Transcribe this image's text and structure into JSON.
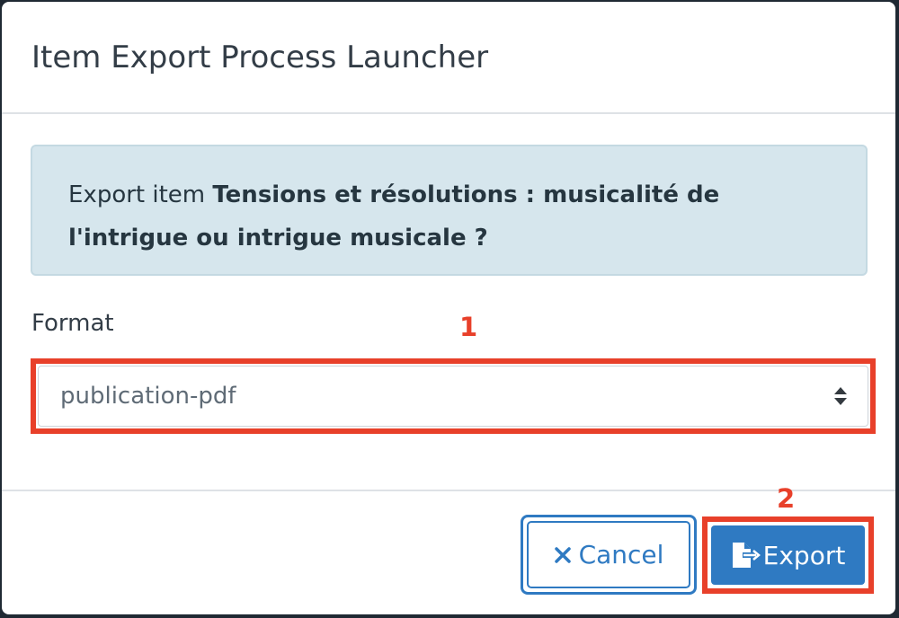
{
  "dialog": {
    "title": "Item Export Process Launcher",
    "message_prefix": "Export item ",
    "item_title": "Tensions et résolutions : musicalité de l'intrigue ou intrigue musicale ?",
    "format_label": "Format",
    "format_selected": "publication-pdf",
    "cancel_label": "Cancel",
    "export_label": "Export"
  },
  "annotations": {
    "marker_1": "1",
    "marker_2": "2"
  },
  "icons": {
    "cancel": "close-icon",
    "export": "file-export-icon",
    "select": "sort-arrows-icon"
  },
  "colors": {
    "primary": "#2f7ac2",
    "highlight": "#e8402a",
    "alert_bg": "#d6e6ed"
  }
}
